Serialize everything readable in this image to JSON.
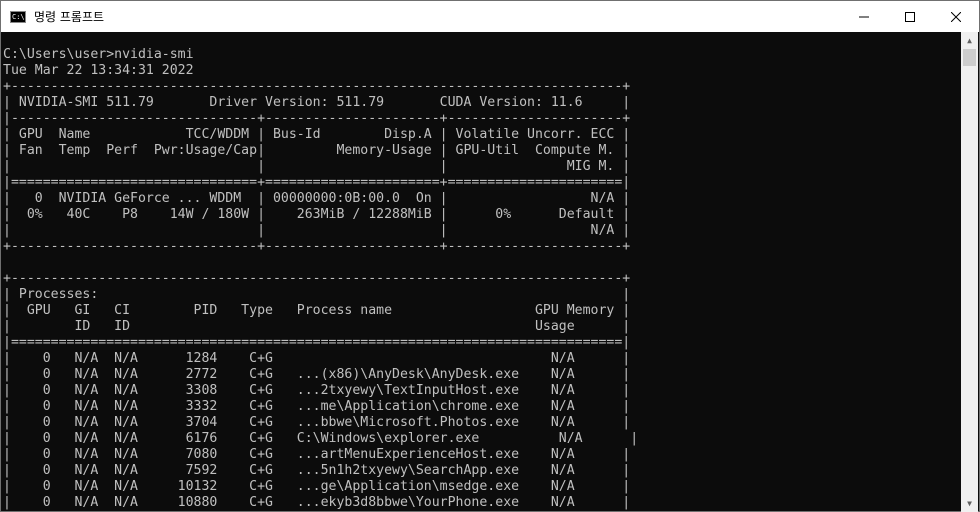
{
  "window": {
    "title": "명령 프롬프트",
    "icon": "cmd-icon"
  },
  "controls": {
    "minimize": "minimize-icon",
    "maximize": "maximize-icon",
    "close": "close-icon"
  },
  "console": {
    "lines": [
      "C:\\Users\\user>nvidia-smi",
      "Tue Mar 22 13:34:31 2022",
      "+-----------------------------------------------------------------------------+",
      "| NVIDIA-SMI 511.79       Driver Version: 511.79       CUDA Version: 11.6     |",
      "|-------------------------------+----------------------+----------------------+",
      "| GPU  Name            TCC/WDDM | Bus-Id        Disp.A | Volatile Uncorr. ECC |",
      "| Fan  Temp  Perf  Pwr:Usage/Cap|         Memory-Usage | GPU-Util  Compute M. |",
      "|                               |                      |               MIG M. |",
      "|===============================+======================+======================|",
      "|   0  NVIDIA GeForce ... WDDM  | 00000000:0B:00.0  On |                  N/A |",
      "|  0%   40C    P8    14W / 180W |    263MiB / 12288MiB |      0%      Default |",
      "|                               |                      |                  N/A |",
      "+-------------------------------+----------------------+----------------------+",
      "",
      "+-----------------------------------------------------------------------------+",
      "| Processes:                                                                  |",
      "|  GPU   GI   CI        PID   Type   Process name                  GPU Memory |",
      "|        ID   ID                                                   Usage      |",
      "|=============================================================================|",
      "|    0   N/A  N/A      1284    C+G                                   N/A      |",
      "|    0   N/A  N/A      2772    C+G   ...(x86)\\AnyDesk\\AnyDesk.exe    N/A      |",
      "|    0   N/A  N/A      3308    C+G   ...2txyewy\\TextInputHost.exe    N/A      |",
      "|    0   N/A  N/A      3332    C+G   ...me\\Application\\chrome.exe    N/A      |",
      "|    0   N/A  N/A      3704    C+G   ...bbwe\\Microsoft.Photos.exe    N/A      |",
      "|    0   N/A  N/A      6176    C+G   C:\\Windows\\explorer.exe          N/A      |",
      "|    0   N/A  N/A      7080    C+G   ...artMenuExperienceHost.exe    N/A      |",
      "|    0   N/A  N/A      7592    C+G   ...5n1h2txyewy\\SearchApp.exe    N/A      |",
      "|    0   N/A  N/A     10132    C+G   ...ge\\Application\\msedge.exe    N/A      |",
      "|    0   N/A  N/A     10880    C+G   ...ekyb3d8bbwe\\YourPhone.exe    N/A      |"
    ]
  }
}
